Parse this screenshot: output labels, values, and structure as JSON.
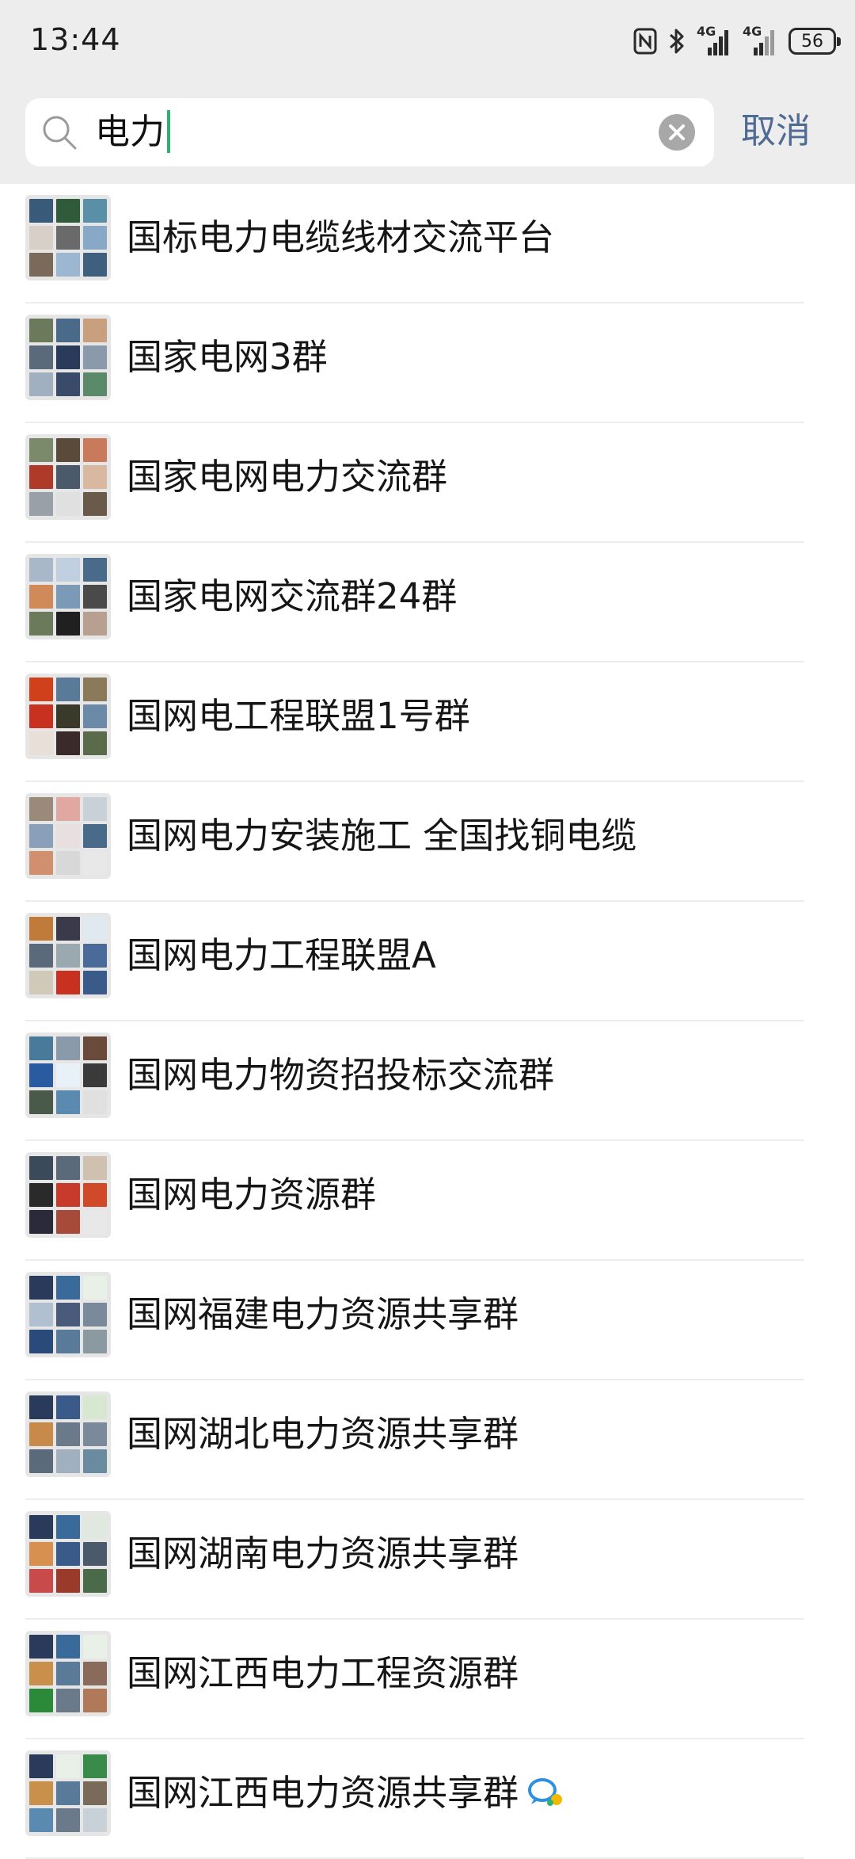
{
  "status_bar": {
    "time": "13:44",
    "icons": [
      "nfc-icon",
      "bluetooth-icon",
      "4g-signal-icon",
      "4g-signal-icon"
    ],
    "net_label_1": "4G",
    "net_label_2": "4G",
    "battery": "56"
  },
  "search": {
    "query": "电力",
    "cancel_label": "取消"
  },
  "groups": [
    {
      "name": "国标电力电缆线材交流平台",
      "tiles": [
        "#3a5a7a",
        "#2f5b3a",
        "#5a8fa8",
        "#d8d0c8",
        "#6a6a6a",
        "#88a8c8",
        "#7a6a5a",
        "#9bb7d2",
        "#3f5f7f"
      ]
    },
    {
      "name": "国家电网3群",
      "tiles": [
        "#6a7a5a",
        "#4a6a8a",
        "#c8a080",
        "#5a6a7a",
        "#2a3a5a",
        "#8a9aaa",
        "#a0b0c0",
        "#3a4a6a",
        "#5a8a6a"
      ]
    },
    {
      "name": "国家电网电力交流群",
      "tiles": [
        "#7a8a6a",
        "#5a4a3a",
        "#c87a5a",
        "#b03a2a",
        "#4a5a6a",
        "#d8b8a0",
        "#9aa0a8",
        "#e0e0e0",
        "#6a5a4a"
      ]
    },
    {
      "name": "国家电网交流群24群",
      "tiles": [
        "#a8b8c8",
        "#c0d0e0",
        "#4a6a8a",
        "#d08a5a",
        "#7a9ab8",
        "#4a4a4a",
        "#6a7a5a",
        "#202020",
        "#b8a090"
      ]
    },
    {
      "name": "国网电工程联盟1号群",
      "tiles": [
        "#d0401a",
        "#5a7a9a",
        "#8a7a5a",
        "#c83020",
        "#3a3a2a",
        "#6a8aa8",
        "#e8e0d8",
        "#3a2a2a",
        "#5a6a4a"
      ]
    },
    {
      "name": "国网电力安装施工 全国找铜电缆",
      "tiles": [
        "#9a8a7a",
        "#e0a8a0",
        "#c8d0d8",
        "#8aa0b8",
        "#e8e0e0",
        "#4a6a8a",
        "#d09070",
        "#d8d8d8",
        "#e8e8e8"
      ]
    },
    {
      "name": "国网电力工程联盟A",
      "tiles": [
        "#c07a3a",
        "#3a3a4a",
        "#e0e8f0",
        "#5a6a7a",
        "#9aa8b0",
        "#4a6a9a",
        "#d0c8b8",
        "#c83020",
        "#3a5a8a"
      ]
    },
    {
      "name": "国网电力物资招投标交流群",
      "tiles": [
        "#4a7a9a",
        "#8a9aaa",
        "#6a4a3a",
        "#2a5aa0",
        "#e8f0f8",
        "#3a3a3a",
        "#4a5a4a",
        "#5a8ab0",
        "#e0e0e0"
      ]
    },
    {
      "name": "国网电力资源群",
      "tiles": [
        "#3a4a5a",
        "#5a6a7a",
        "#d0c0b0",
        "#2a2a2a",
        "#c83a2a",
        "#d04a2a",
        "#2a2a3a",
        "#a84a3a",
        "#e8e8e8"
      ]
    },
    {
      "name": "国网福建电力资源共享群",
      "tiles": [
        "#2a3a5a",
        "#3a6a9a",
        "#e8f0e8",
        "#b0c0d0",
        "#4a5a7a",
        "#7a8a9a",
        "#2a4a7a",
        "#5a7a9a",
        "#8a9aa0"
      ]
    },
    {
      "name": "国网湖北电力资源共享群",
      "tiles": [
        "#2a3a5a",
        "#3a5a8a",
        "#d8e8d0",
        "#c88a4a",
        "#6a7a8a",
        "#7a8a9a",
        "#5a6a7a",
        "#a0b0c0",
        "#6a8aa0"
      ]
    },
    {
      "name": "国网湖南电力资源共享群",
      "tiles": [
        "#2a3a5a",
        "#3a6a9a",
        "#e0e8e0",
        "#d89050",
        "#3a5a8a",
        "#4a5a6a",
        "#c84a4a",
        "#9a3a2a",
        "#4a6a4a"
      ]
    },
    {
      "name": "国网江西电力工程资源群",
      "tiles": [
        "#2a3a5a",
        "#3a6a9a",
        "#e8f0e8",
        "#c8904a",
        "#5a7a9a",
        "#8a6a5a",
        "#2a8a3a",
        "#6a7a8a",
        "#b07a5a"
      ]
    },
    {
      "name": "国网江西电力资源共享群",
      "tiles": [
        "#2a3a5a",
        "#e8f0e8",
        "#3a8a4a",
        "#c8904a",
        "#5a7a9a",
        "#7a6a5a",
        "#5a8ab0",
        "#6a7a8a",
        "#c8d0d8"
      ]
    }
  ],
  "last_row_badge": "chat-bubble-icon",
  "colors": {
    "accent_cancel": "#4f6a93",
    "caret": "#2ab36b",
    "top_background": "#ededed"
  }
}
